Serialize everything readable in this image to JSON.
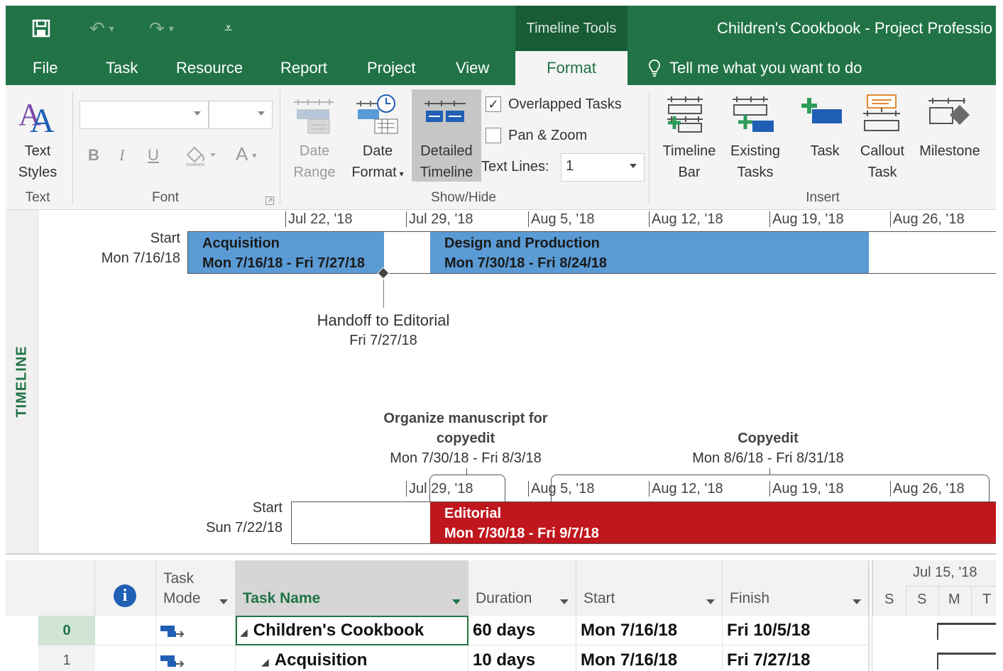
{
  "window": {
    "title": "Children's Cookbook - Project Professio",
    "contextual_tab_group": "Timeline Tools"
  },
  "quick_access": {
    "save_icon": "save-icon",
    "undo_icon": "undo-icon",
    "redo_icon": "redo-icon",
    "customize_icon": "customize-qat-icon"
  },
  "tabs": {
    "file": "File",
    "task": "Task",
    "resource": "Resource",
    "report": "Report",
    "project": "Project",
    "view": "View",
    "format": "Format",
    "tell_me": "Tell me what you want to do"
  },
  "ribbon": {
    "text_group": {
      "text_styles": [
        "Text",
        "Styles"
      ],
      "label": "Text"
    },
    "font_group": {
      "bold": "B",
      "italic": "I",
      "underline": "U",
      "font_color": "A",
      "label": "Font"
    },
    "show_hide_group": {
      "date_range": [
        "Date",
        "Range"
      ],
      "date_format": [
        "Date",
        "Format"
      ],
      "detailed_timeline": [
        "Detailed",
        "Timeline"
      ],
      "overlapped_tasks": "Overlapped Tasks",
      "overlapped_checked": true,
      "pan_zoom": "Pan & Zoom",
      "pan_zoom_checked": false,
      "text_lines_label": "Text Lines:",
      "text_lines_value": "1",
      "label": "Show/Hide"
    },
    "insert_group": {
      "timeline_bar": [
        "Timeline",
        "Bar"
      ],
      "existing_tasks": [
        "Existing",
        "Tasks"
      ],
      "task": "Task",
      "callout_task": [
        "Callout",
        "Task"
      ],
      "milestone": "Milestone",
      "label": "Insert"
    }
  },
  "timeline": {
    "side_label": "TIMELINE",
    "top_lane": {
      "start_label": "Start",
      "start_date": "Mon 7/16/18",
      "ticks": [
        "Jul 22, '18",
        "Jul 29, '18",
        "Aug 5, '18",
        "Aug 12, '18",
        "Aug 19, '18",
        "Aug 26, '18"
      ],
      "bars": [
        {
          "name": "Acquisition",
          "dates": "Mon 7/16/18 - Fri 7/27/18"
        },
        {
          "name": "Design and Production",
          "dates": "Mon 7/30/18 - Fri 8/24/18"
        }
      ],
      "milestone": {
        "name": "Handoff to Editorial",
        "date": "Fri 7/27/18"
      }
    },
    "bottom_lane": {
      "start_label": "Start",
      "start_date": "Sun 7/22/18",
      "ticks": [
        "Jul 29, '18",
        "Aug 5, '18",
        "Aug 12, '18",
        "Aug 19, '18",
        "Aug 26, '18"
      ],
      "callouts": [
        {
          "name_line1": "Organize manuscript for",
          "name_line2": "copyedit",
          "dates": "Mon 7/30/18 - Fri 8/3/18"
        },
        {
          "name_line1": "Copyedit",
          "dates": "Mon 8/6/18 - Fri 8/31/18"
        }
      ],
      "bar": {
        "name": "Editorial",
        "dates": "Mon 7/30/18 - Fri 9/7/18"
      }
    }
  },
  "table": {
    "headers": {
      "info_icon": "info-icon",
      "task_mode": [
        "Task",
        "Mode"
      ],
      "task_name": "Task Name",
      "duration": "Duration",
      "start": "Start",
      "finish": "Finish"
    },
    "gantt_header": {
      "week": "Jul 15, '18",
      "days": [
        "S",
        "S",
        "M",
        "T"
      ]
    },
    "rows": [
      {
        "id": "0",
        "mode_icon": "auto-scheduled-icon",
        "name": "Children's Cookbook",
        "duration": "60 days",
        "start": "Mon 7/16/18",
        "finish": "Fri 10/5/18"
      },
      {
        "id": "1",
        "mode_icon": "auto-scheduled-icon",
        "name": "Acquisition",
        "duration": "10 days",
        "start": "Mon 7/16/18",
        "finish": "Fri 7/27/18"
      }
    ]
  },
  "colors": {
    "app_green": "#217346",
    "bar_blue": "#5b9bd5",
    "bar_red": "#c0161d"
  }
}
